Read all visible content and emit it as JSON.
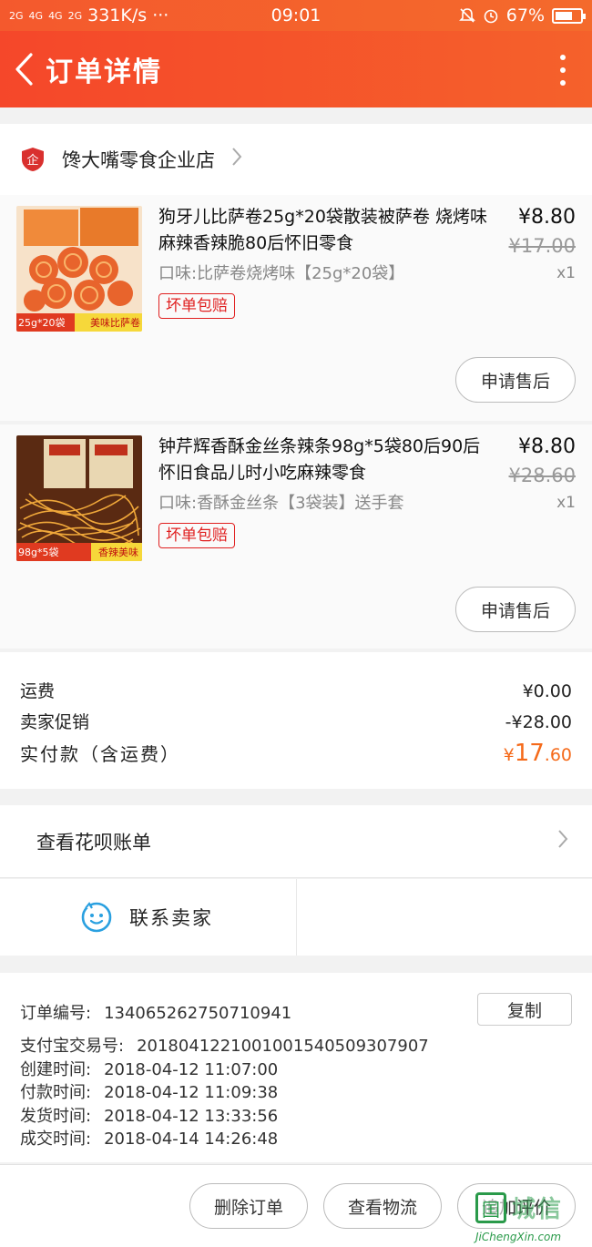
{
  "status_bar": {
    "signal1": "2G",
    "signal2": "4G",
    "signal3": "4G",
    "signal4": "2G",
    "net_speed": "331K/s ···",
    "time": "09:01",
    "battery": "67%"
  },
  "nav": {
    "title": "订单详情"
  },
  "shop": {
    "name": "馋大嘴零食企业店"
  },
  "items": [
    {
      "title": "狗牙儿比萨卷25g*20袋散装被萨卷 烧烤味麻辣香辣脆80后怀旧零食",
      "flavor": "口味:比萨卷烧烤味【25g*20袋】",
      "badge": "坏单包赔",
      "price": "¥8.80",
      "original_price": "¥17.00",
      "qty": "x1",
      "after_sale": "申请售后",
      "img_caption_left": "25g*20袋",
      "img_caption_right": "美味比萨卷"
    },
    {
      "title": "钟芹辉香酥金丝条辣条98g*5袋80后90后怀旧食品儿时小吃麻辣零食",
      "flavor": "口味:香酥金丝条【3袋装】送手套",
      "badge": "坏单包赔",
      "price": "¥8.80",
      "original_price": "¥28.60",
      "qty": "x1",
      "after_sale": "申请售后",
      "img_caption_left": "98g*5袋",
      "img_caption_right": "香辣美味"
    }
  ],
  "fees": {
    "shipping_label": "运费",
    "shipping_value": "¥0.00",
    "promo_label": "卖家促销",
    "promo_value": "-¥28.00",
    "total_label": "实付款（含运费）",
    "total_currency": "¥",
    "total_int": "17",
    "total_dec": ".60"
  },
  "huabei": {
    "label": "查看花呗账单"
  },
  "contact": {
    "label": "联系卖家"
  },
  "order_info": {
    "order_no_label": "订单编号:",
    "order_no": "134065262750710941",
    "copy": "复制",
    "alipay_label": "支付宝交易号:",
    "alipay_no": "2018041221001001540509307907",
    "created_label": "创建时间:",
    "created": "2018-04-12 11:07:00",
    "paid_label": "付款时间:",
    "paid": "2018-04-12 11:09:38",
    "shipped_label": "发货时间:",
    "shipped": "2018-04-12 13:33:56",
    "closed_label": "成交时间:",
    "closed": "2018-04-14 14:26:48"
  },
  "bottom": {
    "delete": "删除订单",
    "logistics": "查看物流",
    "review": "追加评价"
  },
  "watermark": {
    "text": "城信",
    "url": "JiChengXin.com"
  },
  "colors": {
    "brand": "#f5502b",
    "price_accent": "#f56a1a",
    "badge": "#e02020"
  }
}
